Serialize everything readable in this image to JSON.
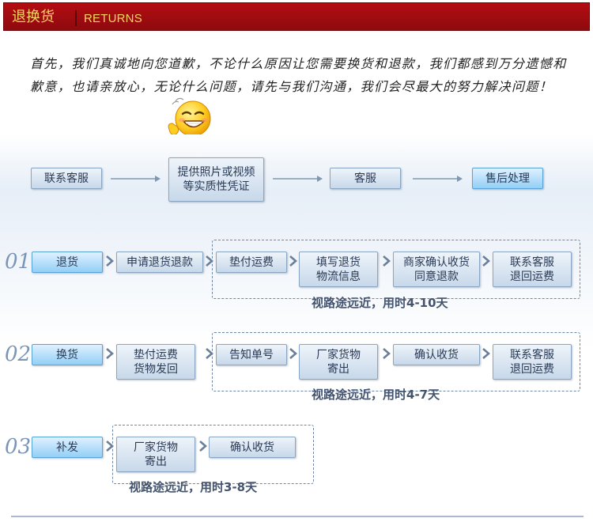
{
  "header": {
    "title_cn": "退换货",
    "title_en": "RETURNS"
  },
  "intro": {
    "text": "首先，我们真诚地向您道歉，不论什么原因让您需要换货和退款，我们都感到万分遗憾和歉意，也请亲放心，无论什么问题，请先与我们沟通，我们会尽最大的努力解决问题！"
  },
  "icons": {
    "smiley": "smiley-face-icon",
    "chevron": "chevron-right-icon",
    "arrow": "long-arrow-right-icon"
  },
  "colors": {
    "header_bg": "#a00c10",
    "header_text": "#f7d463",
    "box_blue": "#93cff6",
    "stage_num": "#7a95b5"
  },
  "process": {
    "steps": [
      "联系客服",
      "提供照片或视频\n等实质性凭证",
      "客服",
      "售后处理"
    ]
  },
  "stages": [
    {
      "num": "01",
      "label": "退货",
      "steps": [
        "申请退货退款",
        "垫付运费",
        "填写退货\n物流信息",
        "商家确认收货\n同意退款",
        "联系客服\n退回运费"
      ],
      "note": "视路途远近，用时4-10天"
    },
    {
      "num": "02",
      "label": "换货",
      "steps": [
        "垫付运费\n货物发回",
        "告知单号",
        "厂家货物\n寄出",
        "确认收货",
        "联系客服\n退回运费"
      ],
      "note": "视路途远近，用时4-7天"
    },
    {
      "num": "03",
      "label": "补发",
      "steps": [
        "厂家货物\n寄出",
        "确认收货"
      ],
      "note": "视路途远近，用时3-8天"
    }
  ]
}
